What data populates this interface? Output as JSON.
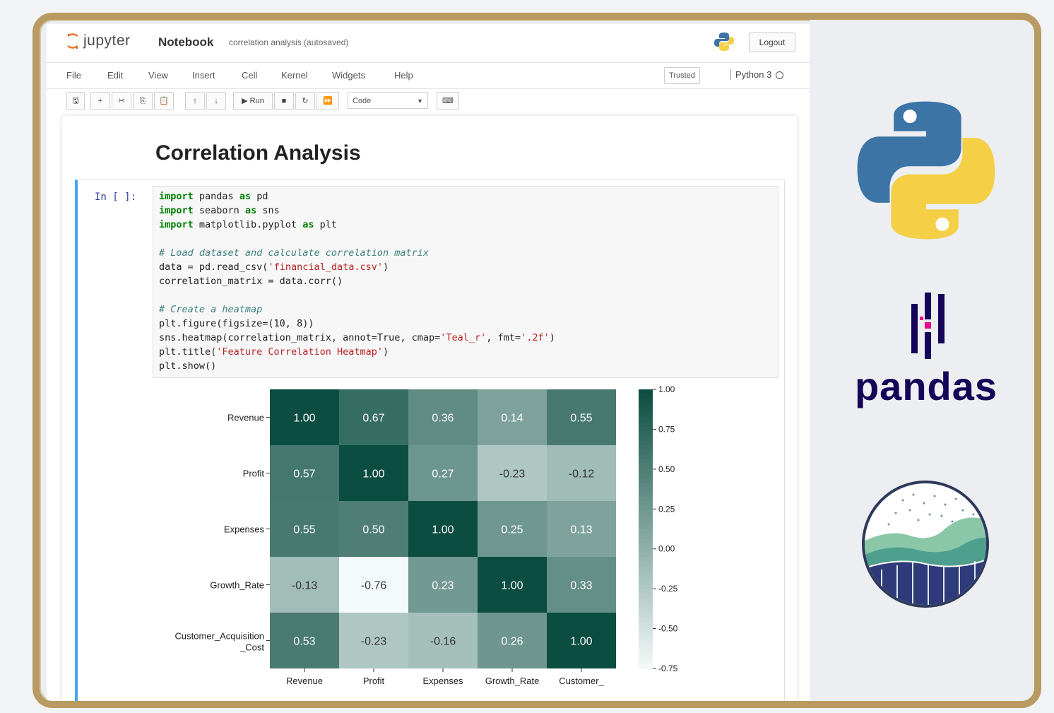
{
  "header": {
    "logo_text": "jupyter",
    "notebook_label": "Notebook",
    "notebook_name": "correlation analysis (autosaved)",
    "logout_label": "Logout"
  },
  "menu": {
    "items": [
      "File",
      "Edit",
      "View",
      "Insert",
      "Cell",
      "Kernel",
      "Widgets",
      "Help"
    ],
    "trusted_label": "Trusted",
    "kernel_label": "Python 3"
  },
  "toolbar": {
    "run_label": "Run",
    "cell_type": "Code",
    "buttons": [
      "save-icon",
      "add-icon",
      "cut-icon",
      "copy-icon",
      "paste-icon",
      "move-up-icon",
      "move-down-icon",
      "run-icon",
      "stop-icon",
      "restart-icon",
      "fast-forward-icon",
      "keyboard-icon"
    ]
  },
  "notebook": {
    "heading": "Correlation Analysis",
    "prompt": "In [ ]:",
    "code_lines": [
      [
        {
          "t": "import",
          "c": "kw"
        },
        {
          "t": " pandas "
        },
        {
          "t": "as",
          "c": "kw"
        },
        {
          "t": " pd"
        }
      ],
      [
        {
          "t": "import",
          "c": "kw"
        },
        {
          "t": " seaborn "
        },
        {
          "t": "as",
          "c": "kw"
        },
        {
          "t": " sns"
        }
      ],
      [
        {
          "t": "import",
          "c": "kw"
        },
        {
          "t": " matplotlib.pyplot "
        },
        {
          "t": "as",
          "c": "kw"
        },
        {
          "t": " plt"
        }
      ],
      [],
      [
        {
          "t": "# Load dataset and calculate correlation matrix",
          "c": "cm"
        }
      ],
      [
        {
          "t": "data = pd.read_csv("
        },
        {
          "t": "'financial_data.csv'",
          "c": "st"
        },
        {
          "t": ")"
        }
      ],
      [
        {
          "t": "correlation_matrix = data.corr()"
        }
      ],
      [],
      [
        {
          "t": "# Create a heatmap",
          "c": "cm"
        }
      ],
      [
        {
          "t": "plt.figure(figsize=(10, 8))"
        }
      ],
      [
        {
          "t": "sns.heatmap(correlation_matrix, annot=True, cmap="
        },
        {
          "t": "'Teal_r'",
          "c": "st"
        },
        {
          "t": ", fmt="
        },
        {
          "t": "'.2f'",
          "c": "st"
        },
        {
          "t": ")"
        }
      ],
      [
        {
          "t": "plt.title("
        },
        {
          "t": "'Feature Correlation Heatmap'",
          "c": "st"
        },
        {
          "t": ")"
        }
      ],
      [
        {
          "t": "plt.show()"
        }
      ]
    ]
  },
  "chart_data": {
    "type": "heatmap",
    "title": "",
    "xlabel": "",
    "ylabel": "",
    "row_labels": [
      "Revenue",
      "Profit",
      "Expenses",
      "Growth_Rate",
      "Customer_Acquisition_Cost"
    ],
    "col_labels": [
      "Revenue",
      "Profit",
      "Expenses",
      "Growth_Rate",
      "Customer_"
    ],
    "values": [
      [
        1.0,
        0.67,
        0.36,
        0.14,
        0.55
      ],
      [
        0.57,
        1.0,
        0.27,
        -0.23,
        -0.12
      ],
      [
        0.55,
        0.5,
        1.0,
        0.25,
        0.13
      ],
      [
        -0.13,
        -0.76,
        0.23,
        1.0,
        0.33
      ],
      [
        0.53,
        -0.23,
        -0.16,
        0.26,
        1.0
      ]
    ],
    "colorbar_ticks": [
      "1.00",
      "0.75",
      "0.50",
      "0.25",
      "0.00",
      "-0.25",
      "-0.50",
      "-0.75"
    ],
    "zlim": [
      -0.75,
      1.0
    ],
    "colormap": [
      "#f4fafa",
      "#0b4d40"
    ],
    "annot_fmt": ".2f",
    "grid": false
  },
  "side": {
    "pandas_label": "pandas"
  },
  "colors": {
    "python_blue": "#3c74a6",
    "python_yellow": "#f5cf45",
    "pandas_navy": "#150458",
    "pandas_pink": "#e70488",
    "frame_gold": "#b89a62",
    "cell_accent": "#42a5f5"
  }
}
